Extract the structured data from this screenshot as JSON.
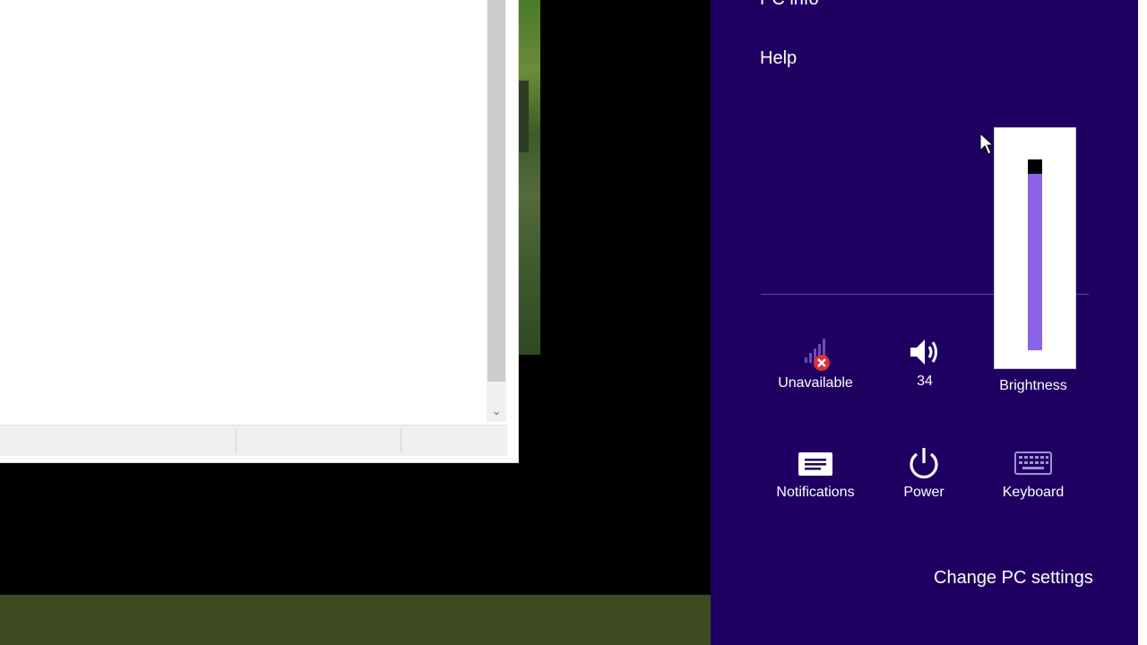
{
  "charm": {
    "top_link_partial": "PC info",
    "help": "Help",
    "change_settings": "Change PC settings",
    "background": "#1f0062",
    "accent": "#8a63e8"
  },
  "tiles": {
    "network": {
      "label": "Unavailable",
      "icon": "network-unavailable-icon"
    },
    "volume": {
      "label": "34",
      "icon": "speaker-icon"
    },
    "brightness": {
      "label": "Brightness",
      "icon": "brightness-icon",
      "level": 0.94
    },
    "notifications": {
      "label": "Notifications",
      "icon": "notifications-icon"
    },
    "power": {
      "label": "Power",
      "icon": "power-icon"
    },
    "keyboard": {
      "label": "Keyboard",
      "icon": "keyboard-icon"
    }
  }
}
